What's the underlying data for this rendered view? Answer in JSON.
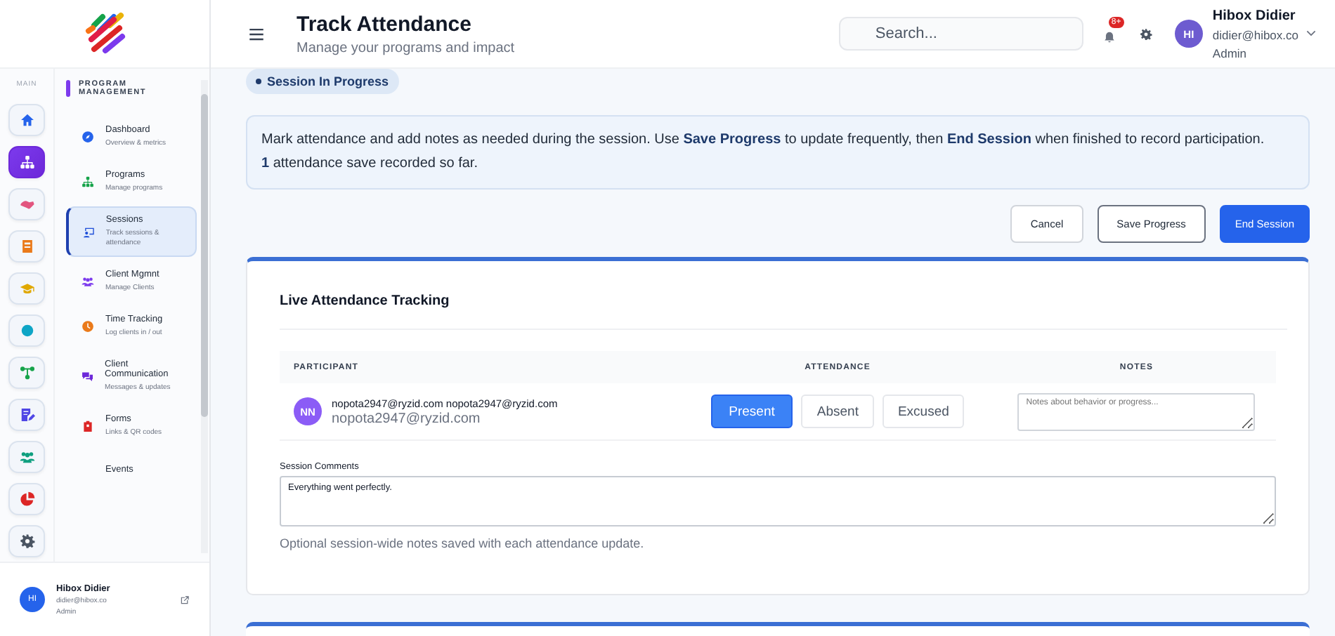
{
  "sidebar": {
    "rail_title": "MAIN",
    "rail": [
      {
        "color": "#2563eb",
        "selected": false
      },
      {
        "color": "#ffffff",
        "selected": true
      },
      {
        "color": "#e2557f",
        "selected": false
      },
      {
        "color": "#ea7a1a",
        "selected": false
      },
      {
        "color": "#e0a800",
        "selected": false
      },
      {
        "color": "#0ea5c6",
        "selected": false
      },
      {
        "color": "#16a34a",
        "selected": false
      },
      {
        "color": "#4f46e5",
        "selected": false
      },
      {
        "color": "#0f9f7f",
        "selected": false
      },
      {
        "color": "#dc2626",
        "selected": false
      },
      {
        "color": "#4b5563",
        "selected": false
      }
    ],
    "section_title": "PROGRAM MANAGEMENT",
    "items": [
      {
        "title": "Dashboard",
        "subtitle": "Overview & metrics",
        "selected": false
      },
      {
        "title": "Programs",
        "subtitle": "Manage programs",
        "selected": false
      },
      {
        "title": "Sessions",
        "subtitle": "Track sessions & attendance",
        "selected": true
      },
      {
        "title": "Client Mgmnt",
        "subtitle": "Manage Clients",
        "selected": false
      },
      {
        "title": "Time Tracking",
        "subtitle": "Log clients in / out",
        "selected": false
      },
      {
        "title": "Client Communication",
        "subtitle": "Messages & updates",
        "selected": false
      },
      {
        "title": "Forms",
        "subtitle": "Links & QR codes",
        "selected": false
      },
      {
        "title": "Events"
      }
    ],
    "user": {
      "initials": "HI",
      "name": "Hibox Didier",
      "email": "didier@hibox.co",
      "role": "Admin"
    }
  },
  "header": {
    "title": "Track Attendance",
    "subtitle": "Manage your programs and impact",
    "search": {
      "placeholder": "Search..."
    },
    "notification_count": "8+",
    "user": {
      "initials": "HI",
      "name": "Hibox Didier",
      "email": "didier@hibox.co",
      "role": "Admin"
    }
  },
  "status_badge": "Session In Progress",
  "info": {
    "text": "Mark attendance and add notes as needed during the session. Use **Save Progress** to update frequently, then **End Session** when finished to record participation.",
    "count_text": "**1** attendance save recorded so far."
  },
  "actions": [
    "Cancel",
    "Save Progress",
    "End Session"
  ],
  "attendance_card": {
    "title": "Live Attendance Tracking",
    "columns": [
      "PARTICIPANT",
      "ATTENDANCE",
      "NOTES"
    ],
    "rows": [
      {
        "initials": "NN",
        "name": "nopota2947@ryzid.com nopota2947@ryzid.com",
        "email": "nopota2947@ryzid.com",
        "options": [
          {
            "label": "Present",
            "selected": true
          },
          {
            "label": "Absent",
            "selected": false
          },
          {
            "label": "Excused",
            "selected": false
          }
        ],
        "notes": {
          "placeholder": "Notes about behavior or progress..."
        }
      }
    ],
    "comments": {
      "label": "Session Comments",
      "value": "Everything went perfectly.",
      "hint": "Optional session-wide notes saved with each attendance update."
    }
  }
}
